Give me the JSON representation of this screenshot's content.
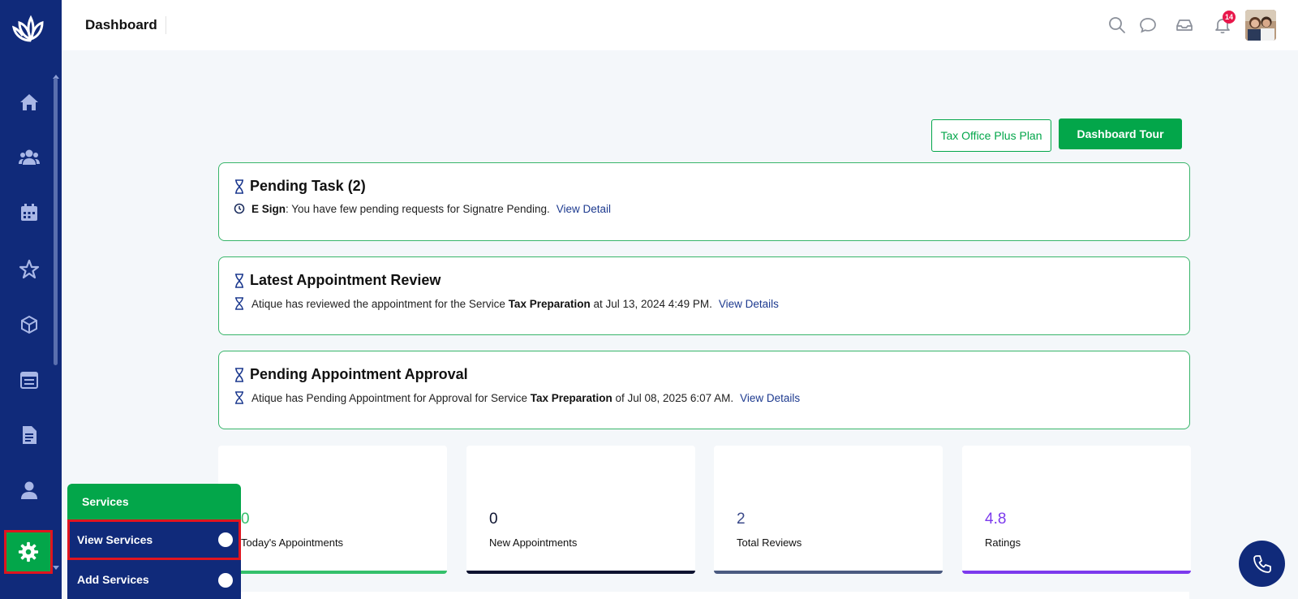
{
  "header": {
    "title": "Dashboard",
    "notification_count": "14"
  },
  "sidebar": {
    "items": [
      {
        "icon": "home-icon"
      },
      {
        "icon": "users-icon"
      },
      {
        "icon": "calendar-icon"
      },
      {
        "icon": "star-icon"
      },
      {
        "icon": "cube-icon"
      },
      {
        "icon": "calendar-list-icon"
      },
      {
        "icon": "document-icon"
      },
      {
        "icon": "user-icon"
      },
      {
        "icon": "gear-icon",
        "active": true
      }
    ]
  },
  "actions": {
    "plan_label": "Tax Office Plus Plan",
    "tour_label": "Dashboard Tour"
  },
  "pending_task": {
    "title": "Pending Task (2)",
    "label": "E Sign",
    "text": ": You have few pending requests for Signatre Pending.",
    "link": "View Detail"
  },
  "latest_review": {
    "title": "Latest Appointment Review",
    "text_before": "Atique has reviewed the appointment for the Service ",
    "service": "Tax Preparation",
    "text_after": " at Jul 13, 2024 4:49 PM.",
    "link": "View Details"
  },
  "pending_approval": {
    "title": "Pending Appointment Approval",
    "text_before": "Atique has Pending Appointment for Approval for Service ",
    "service": "Tax Preparation",
    "text_after": " of Jul 08, 2025 6:07 AM.",
    "link": "View Details"
  },
  "stats": [
    {
      "value": "0",
      "label": "Today's Appointments",
      "color": "#34c06b"
    },
    {
      "value": "0",
      "label": "New Appointments",
      "color": "#0d1330"
    },
    {
      "value": "2",
      "label": "Total Reviews",
      "color": "#4a5a80"
    },
    {
      "value": "4.8",
      "label": "Ratings",
      "color": "#7c3aed"
    }
  ],
  "services_menu": {
    "title": "Services",
    "items": [
      {
        "label": "View Services",
        "active": true
      },
      {
        "label": "Add Services",
        "active": false
      }
    ]
  },
  "colors": {
    "sidebar": "#102a7a",
    "accent_green": "#03a64a",
    "link_blue": "#1d3a8f"
  }
}
